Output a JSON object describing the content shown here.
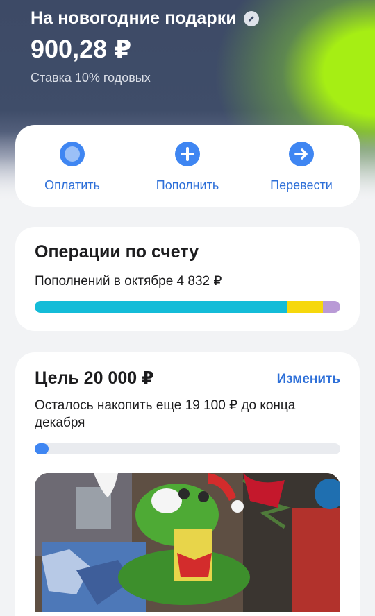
{
  "header": {
    "title": "На новогодние подарки",
    "balance": "900,28 ₽",
    "rate": "Ставка 10% годовых"
  },
  "actions": [
    {
      "label": "Оплатить",
      "icon": "pay-dot-icon"
    },
    {
      "label": "Пополнить",
      "icon": "plus-icon"
    },
    {
      "label": "Перевести",
      "icon": "arrow-right-icon"
    }
  ],
  "operations": {
    "title": "Операции по счету",
    "subtitle": "Пополнений в октябре 4 832 ₽",
    "segments": [
      {
        "share": 0.828,
        "color": "#14bcd8"
      },
      {
        "share": 0.115,
        "color": "#f6d80c"
      },
      {
        "share": 0.057,
        "color": "#b99ad6"
      }
    ]
  },
  "goal": {
    "title": "Цель 20 000 ₽",
    "change_label": "Изменить",
    "subtitle": "Осталось накопить еще 19 100 ₽ до конца декабря",
    "progress": 0.045
  },
  "colors": {
    "accent": "#3f86f2",
    "link": "#2d6fd8",
    "lime": "#a6ee14",
    "header_bg": "#3f4d69"
  }
}
